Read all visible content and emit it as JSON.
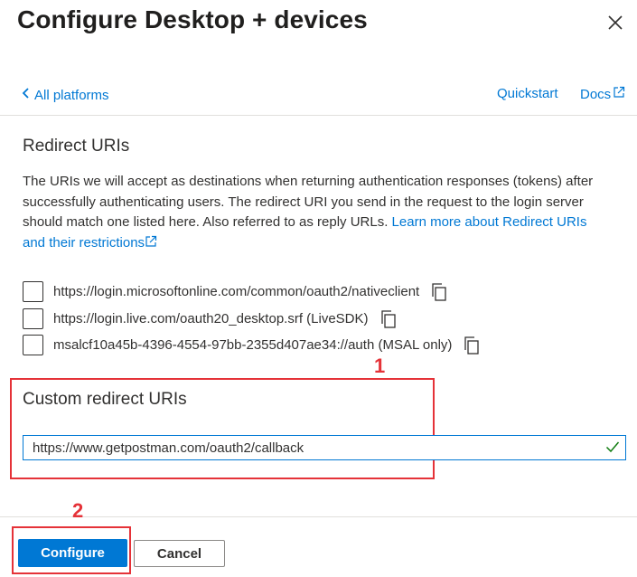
{
  "panel": {
    "title": "Configure Desktop + devices",
    "close_icon": "close-icon"
  },
  "nav": {
    "back_label": "All platforms",
    "quickstart_label": "Quickstart",
    "docs_label": "Docs"
  },
  "redirect_uris": {
    "section_title": "Redirect URIs",
    "description": "The URIs we will accept as destinations when returning authentication responses (tokens) after successfully authenticating users. The redirect URI you send in the request to the login server should match one listed here. Also referred to as reply URLs.",
    "learn_more_label": "Learn more about Redirect URIs and their restrictions",
    "items": [
      {
        "uri": "https://login.microsoftonline.com/common/oauth2/nativeclient",
        "checked": false
      },
      {
        "uri": "https://login.live.com/oauth20_desktop.srf (LiveSDK)",
        "checked": false
      },
      {
        "uri": "msalcf10a45b-4396-4554-97bb-2355d407ae34://auth (MSAL only)",
        "checked": false
      }
    ]
  },
  "custom_redirect": {
    "section_title": "Custom redirect URIs",
    "value": "https://www.getpostman.com/oauth2/callback",
    "valid": true
  },
  "annotations": {
    "marker_1": "1",
    "marker_2": "2",
    "color": "#e53238"
  },
  "footer": {
    "configure_label": "Configure",
    "cancel_label": "Cancel"
  },
  "colors": {
    "accent": "#0078d4",
    "text": "#323130",
    "valid_check": "#107c10"
  }
}
